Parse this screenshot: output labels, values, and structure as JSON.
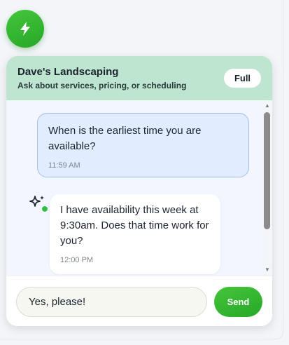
{
  "launcher": {
    "icon": "lightning-bolt-icon",
    "color": "#36b832"
  },
  "header": {
    "title": "Dave's Landscaping",
    "subtitle": "Ask about services, pricing, or scheduling",
    "full_label": "Full",
    "background": "#bde5d0"
  },
  "messages": [
    {
      "role": "user",
      "text": "When is the earliest time you are available?",
      "time": "11:59 AM"
    },
    {
      "role": "bot",
      "text": "I have availability this week at 9:30am. Does that time work for you?",
      "time": "12:00 PM",
      "avatar_icon": "sparkle-icon",
      "status": "online"
    }
  ],
  "composer": {
    "value": "Yes, please!",
    "send_label": "Send"
  }
}
